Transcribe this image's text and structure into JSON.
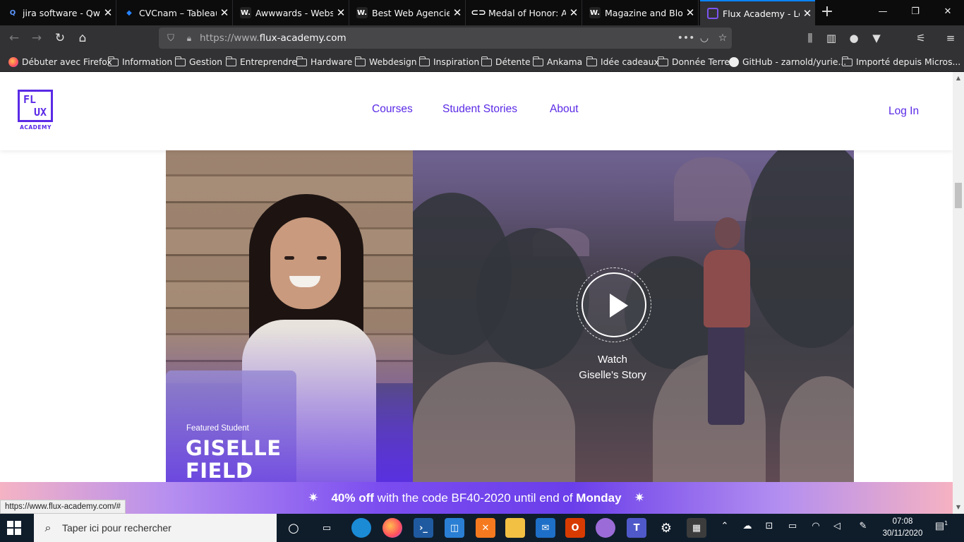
{
  "tabs": [
    {
      "title": "jira software - Qwan",
      "favicon": "qwant-icon",
      "favicon_color": "#5c97ff",
      "active": false
    },
    {
      "title": "CVCnam – Tableau Ji",
      "favicon": "jira-icon",
      "favicon_color": "#2684ff",
      "active": false
    },
    {
      "title": "Awwwards - Website",
      "favicon": "awwwards-icon",
      "favicon_color": "#222222",
      "active": false
    },
    {
      "title": "Best Web Agencies |",
      "favicon": "awwwards-icon",
      "favicon_color": "#222222",
      "active": false
    },
    {
      "title": "Medal of Honor: Ab",
      "favicon": "oculus-icon",
      "favicon_color": "#ffffff",
      "active": false
    },
    {
      "title": "Magazine and Blog",
      "favicon": "awwwards-icon",
      "favicon_color": "#222222",
      "active": false
    },
    {
      "title": "Flux Academy - Lea",
      "favicon": "flux-icon",
      "favicon_color": "#5a2ae6",
      "active": true
    }
  ],
  "window_controls": {
    "minimize": "—",
    "maximize": "❐",
    "close": "✕"
  },
  "url": {
    "prefix": "https://www.",
    "domain": "flux-academy.com"
  },
  "bookmarks": [
    {
      "label": "Débuter avec Firefox",
      "icon": "firefox-icon"
    },
    {
      "label": "Information",
      "icon": "folder-icon"
    },
    {
      "label": "Gestion",
      "icon": "folder-icon"
    },
    {
      "label": "Entreprendre",
      "icon": "folder-icon"
    },
    {
      "label": "Hardware",
      "icon": "folder-icon"
    },
    {
      "label": "Webdesign",
      "icon": "folder-icon"
    },
    {
      "label": "Inspiration",
      "icon": "folder-icon"
    },
    {
      "label": "Détente",
      "icon": "folder-icon"
    },
    {
      "label": "Ankama",
      "icon": "folder-icon"
    },
    {
      "label": "Idée cadeaux",
      "icon": "folder-icon"
    },
    {
      "label": "Donnée Terre",
      "icon": "folder-icon"
    },
    {
      "label": "GitHub - zarnold/yurie...",
      "icon": "github-icon"
    },
    {
      "label": "Importé depuis Micros...",
      "icon": "folder-icon"
    }
  ],
  "site": {
    "logo_text": "FLUX",
    "logo_sub": "ACADEMY",
    "nav": [
      "Courses",
      "Student Stories",
      "About"
    ],
    "login": "Log In",
    "accent": "#5a2ae6"
  },
  "hero": {
    "featured_label": "Featured Student",
    "name_line1": "GISELLE",
    "name_line2": "FIELD",
    "watch_line1": "Watch",
    "watch_line2": "Giselle's Story"
  },
  "promo": {
    "discount": "40% off",
    "middle": " with the code BF40-2020 until end of ",
    "day": "Monday"
  },
  "status_link": "https://www.flux-academy.com/#",
  "taskbar": {
    "search_placeholder": "Taper ici pour rechercher",
    "time": "07:08",
    "date": "30/11/2020",
    "notification_count": "1"
  }
}
